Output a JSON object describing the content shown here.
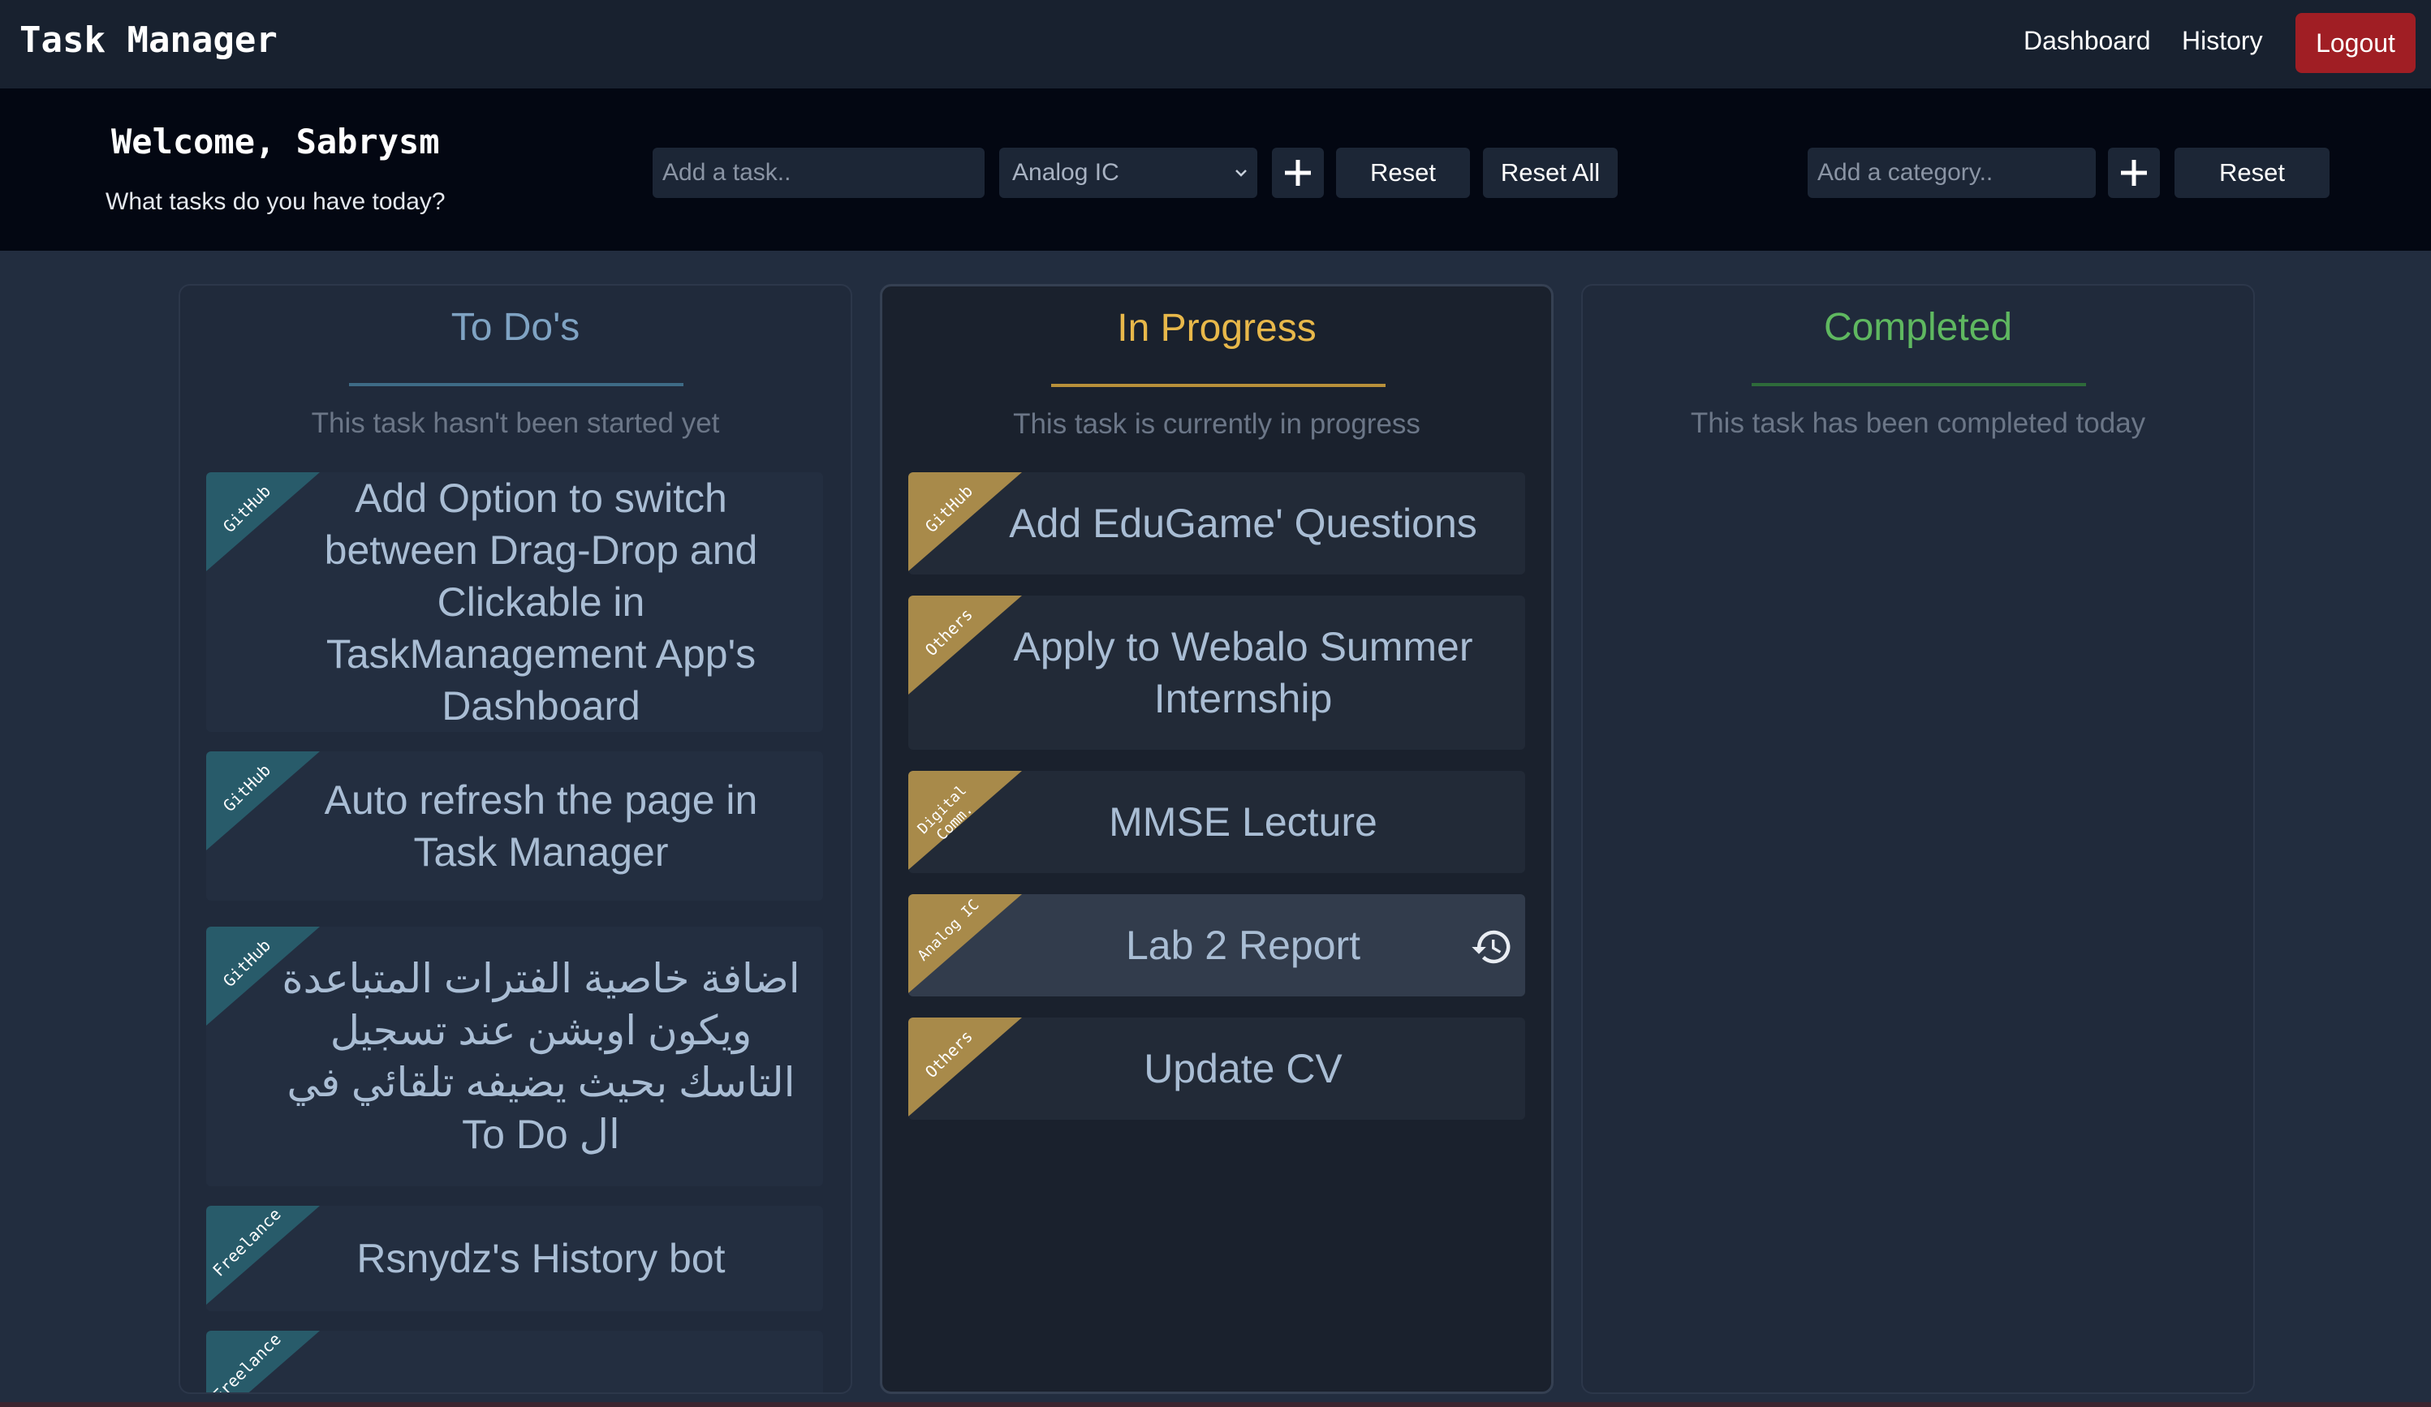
{
  "navbar": {
    "brand": "Task Manager",
    "links": [
      "Dashboard",
      "History"
    ],
    "logout": "Logout"
  },
  "header": {
    "welcome": "Welcome, Sabrysm",
    "subtitle": "What tasks do you have today?",
    "task_input_placeholder": "Add a task..",
    "category_select_value": "Analog IC",
    "reset_label": "Reset",
    "reset_all_label": "Reset All",
    "category_input_placeholder": "Add a category..",
    "category_reset_label": "Reset"
  },
  "columns": [
    {
      "title": "To Do's",
      "subtitle": "This task hasn't been started yet",
      "color": "#7fa3c3",
      "line_color": "#3e6b86",
      "tasks": [
        {
          "category": "GitHub",
          "text": "Add Option to switch between Drag-Drop and Clickable in TaskManagement App's Dashboard"
        },
        {
          "category": "GitHub",
          "text": "Auto refresh the page in Task Manager"
        },
        {
          "category": "GitHub",
          "text": "اضافة خاصية الفترات المتباعدة ويكون اوبشن عند تسجيل التاسك بحيث يضيفه تلقائي في ال To Do"
        },
        {
          "category": "Freelance",
          "text": "Rsnydz's History bot"
        },
        {
          "category": "Freelance",
          "text": ""
        }
      ]
    },
    {
      "title": "In Progress",
      "subtitle": "This task is currently in progress",
      "color": "#e8b84a",
      "line_color": "#b8903a",
      "tasks": [
        {
          "category": "GitHub",
          "text": "Add EduGame' Questions"
        },
        {
          "category": "Others",
          "text": "Apply to Webalo Summer Internship"
        },
        {
          "category": "Digital Comm.",
          "text": "MMSE Lecture"
        },
        {
          "category": "Analog IC",
          "text": "Lab 2 Report",
          "icon": "history-icon"
        },
        {
          "category": "Others",
          "text": "Update CV"
        }
      ]
    },
    {
      "title": "Completed",
      "subtitle": "This task has been completed today",
      "color": "#5fb860",
      "line_color": "#2e6b3a",
      "tasks": []
    }
  ],
  "colors": {
    "todo_ribbon": "#285b6a",
    "progress_ribbon": "#a88a4a",
    "logout": "#a01e24"
  }
}
